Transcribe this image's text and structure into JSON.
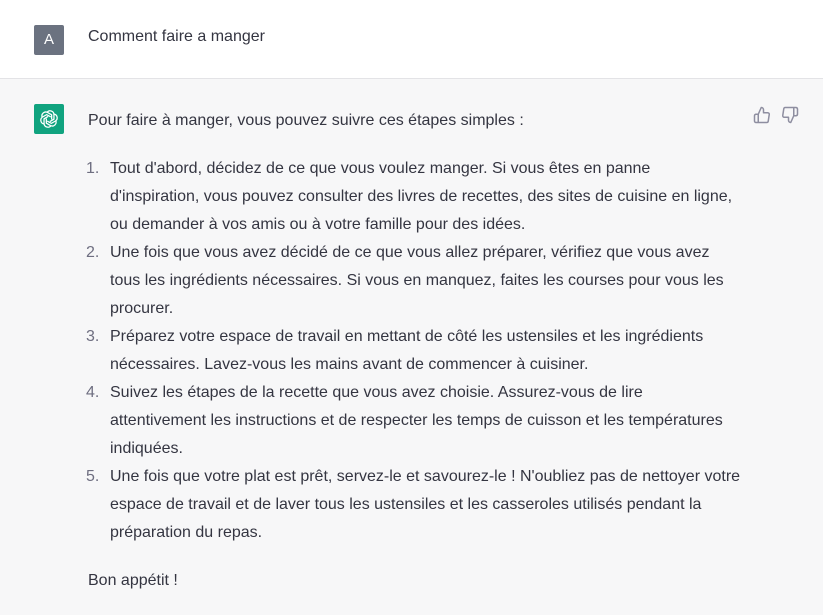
{
  "user": {
    "avatar_letter": "A",
    "message": "Comment faire a manger"
  },
  "assistant": {
    "intro": "Pour faire à manger, vous pouvez suivre ces étapes simples :",
    "steps": [
      {
        "num": "1.",
        "text": "Tout d'abord, décidez de ce que vous voulez manger. Si vous êtes en panne d'inspiration, vous pouvez consulter des livres de recettes, des sites de cuisine en ligne, ou demander à vos amis ou à votre famille pour des idées."
      },
      {
        "num": "2.",
        "text": "Une fois que vous avez décidé de ce que vous allez préparer, vérifiez que vous avez tous les ingrédients nécessaires. Si vous en manquez, faites les courses pour vous les procurer."
      },
      {
        "num": "3.",
        "text": "Préparez votre espace de travail en mettant de côté les ustensiles et les ingrédients nécessaires. Lavez-vous les mains avant de commencer à cuisiner."
      },
      {
        "num": "4.",
        "text": "Suivez les étapes de la recette que vous avez choisie. Assurez-vous de lire attentivement les instructions et de respecter les temps de cuisson et les températures indiquées."
      },
      {
        "num": "5.",
        "text": "Une fois que votre plat est prêt, servez-le et savourez-le ! N'oubliez pas de nettoyer votre espace de travail et de laver tous les ustensiles et les casseroles utilisés pendant la préparation du repas."
      }
    ],
    "closing": "Bon appétit !"
  },
  "icons": {
    "user_avatar": "user-avatar",
    "assistant_avatar": "openai-logo-icon",
    "thumbs_up": "thumbs-up-icon",
    "thumbs_down": "thumbs-down-icon"
  },
  "colors": {
    "assistant_avatar_bg": "#10a37f",
    "user_avatar_bg": "#6b7280",
    "assistant_row_bg": "#f7f7f8",
    "user_row_bg": "#ffffff"
  }
}
